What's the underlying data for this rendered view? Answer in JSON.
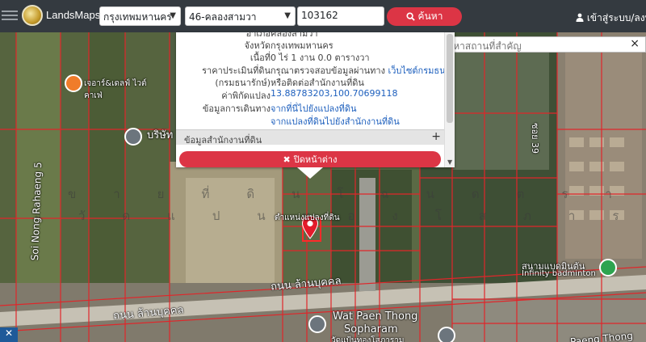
{
  "app": {
    "brand": "LandsMaps"
  },
  "header": {
    "province": "กรุงเทพมหานคร",
    "district": "46-คลองสามวา",
    "parcel_number": "103162",
    "search_label": "ค้นหา",
    "login_label": "เข้าสู่ระบบ/ลงทะ"
  },
  "place_search": {
    "placeholder": "ค้นหาสถานที่สำคัญ"
  },
  "popup": {
    "rows": [
      {
        "key": "อำเภอ",
        "value": "คลองสามวา"
      },
      {
        "key": "จังหวัด",
        "value": "กรุงเทพมหานคร"
      },
      {
        "key": "เนื้อที่",
        "value": "0 ไร่ 1 งาน 0.0 ตารางวา"
      },
      {
        "key": "ราคาประเมินที่ดิน",
        "value": "กรุณาตรวจสอบข้อมูลผ่านทาง",
        "link": "เว็บไซต์กรมธนารักษ์"
      },
      {
        "key": "(กรมธนารักษ์)",
        "value": "หรือติดต่อสำนักงานที่ดิน"
      },
      {
        "key": "ค่าพิกัดแปลง",
        "link": "13.88783203,100.70699118"
      },
      {
        "key": "ข้อมูลการเดินทาง",
        "link": "จากที่นี่ไปยังแปลงที่ดิน"
      },
      {
        "key": "",
        "link": "จากแปลงที่ดินไปยังสำนักงานที่ดิน"
      }
    ],
    "accordion_label": "ข้อมูลสำนักงานที่ดิน",
    "close_label": "ปิดหน้าต่าง"
  },
  "map": {
    "watermark_line1": "ขายที่ดินโฉนดตรา",
    "watermark_line2": "อวัดแปนทองโสภาราม(ทับยา",
    "labels": {
      "cafe": "เจอาร์&เดลฟ์ ไวต์คาเฟ่",
      "parcel_marker": "ตำแหน่งแปลงที่ดิน",
      "road_left": "Soi Nong Rahaeng 5",
      "road_bottom": "ถนน ล้านบุคคล",
      "road_bottom2": "ถนน ล้านบุคคล",
      "temple_en": "Wat Paen Thong",
      "temple_en2": "Sopharam",
      "temple_th": "วัดแป้นทองโสภาราม",
      "badminton_th": "สนามแบดมินตัน",
      "badminton_en": "Infinity badminton",
      "road_right": "Paeng Thong",
      "road_top_right": "ซอย 39",
      "poi_left": "บริษัท"
    }
  }
}
